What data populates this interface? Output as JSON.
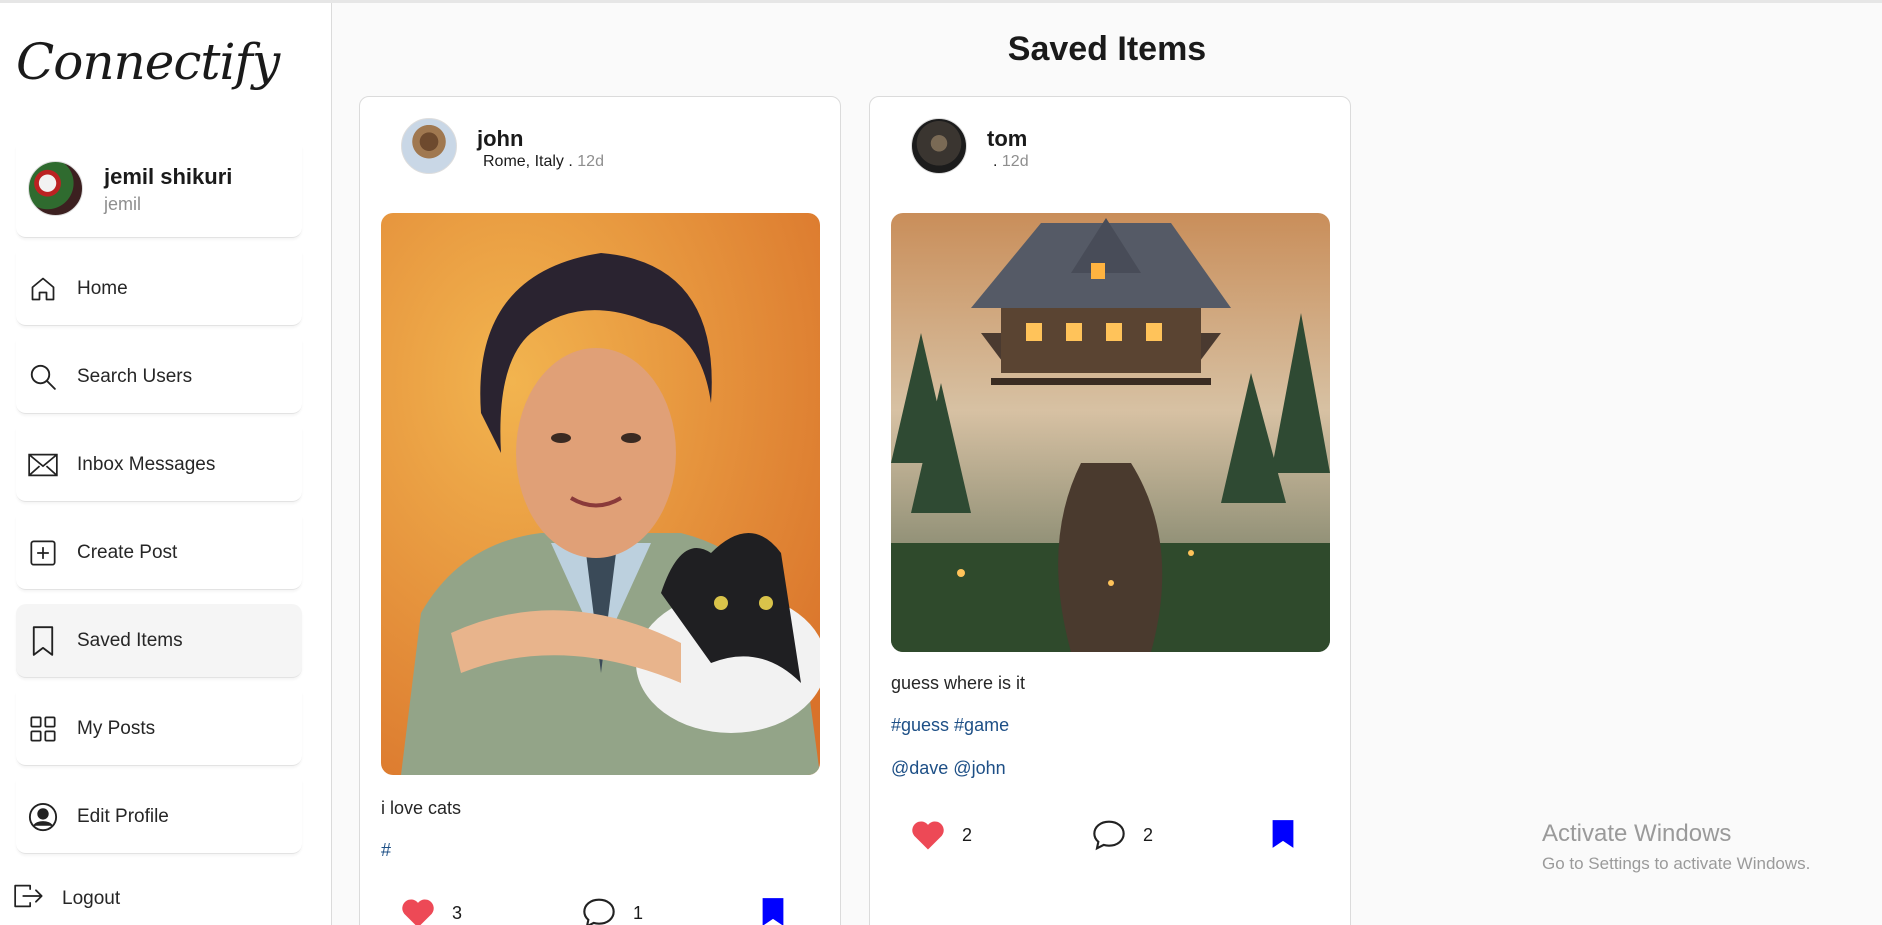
{
  "app": {
    "logo": "Connectify"
  },
  "user": {
    "name": "jemil shikuri",
    "handle": "jemil"
  },
  "sidebar": {
    "items": [
      {
        "label": "Home",
        "icon": "home-icon"
      },
      {
        "label": "Search Users",
        "icon": "search-icon"
      },
      {
        "label": "Inbox Messages",
        "icon": "envelope-icon"
      },
      {
        "label": "Create Post",
        "icon": "plus-square-icon"
      },
      {
        "label": "Saved Items",
        "icon": "bookmark-icon",
        "active": true
      },
      {
        "label": "My Posts",
        "icon": "grid-icon"
      },
      {
        "label": "Edit Profile",
        "icon": "user-circle-icon"
      }
    ],
    "logout": "Logout"
  },
  "page": {
    "title": "Saved Items"
  },
  "posts": [
    {
      "username": "john",
      "location": "Rome, Italy .",
      "time": "12d",
      "caption": "i love cats",
      "hashtags": "#",
      "mentions": "",
      "likes": "3",
      "comments": "1",
      "saved": true
    },
    {
      "username": "tom",
      "location": " .",
      "time": "12d",
      "caption": "guess where is it",
      "hashtags": "#guess #game",
      "mentions": "@dave @john",
      "likes": "2",
      "comments": "2",
      "saved": true
    }
  ],
  "colors": {
    "like": "#ed4956",
    "bookmark": "#0000ff",
    "link": "#1d4f86"
  },
  "watermark": {
    "line1": "Activate Windows",
    "line2": "Go to Settings to activate Windows."
  }
}
